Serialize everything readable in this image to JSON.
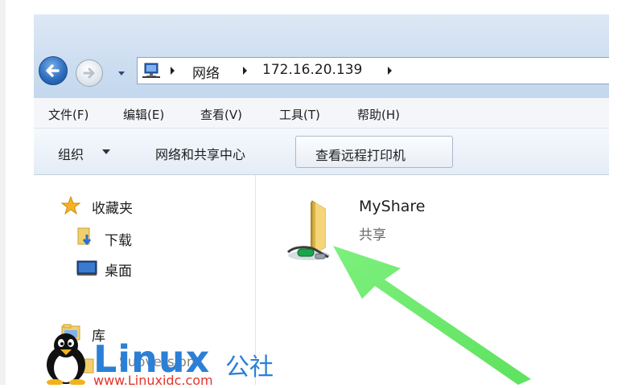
{
  "address": {
    "crumbs": [
      "网络",
      "172.16.20.139"
    ]
  },
  "menu": [
    "文件(F)",
    "编辑(E)",
    "查看(V)",
    "工具(T)",
    "帮助(H)"
  ],
  "toolbar": {
    "organize": "组织",
    "network_center": "网络和共享中心",
    "view_printers": "查看远程打印机"
  },
  "nav": {
    "favorites": "收藏夹",
    "downloads": "下载",
    "desktop": "桌面",
    "libraries": "库",
    "subversion": "Subversion"
  },
  "share_item": {
    "name": "MyShare",
    "type": "共享"
  },
  "watermark": {
    "brand": "Linux",
    "suffix": "公社",
    "url": "www.Linuxidc.com"
  },
  "colors": {
    "annotation_arrow": "#66ee66",
    "brand_blue": "#2b7fd6"
  }
}
